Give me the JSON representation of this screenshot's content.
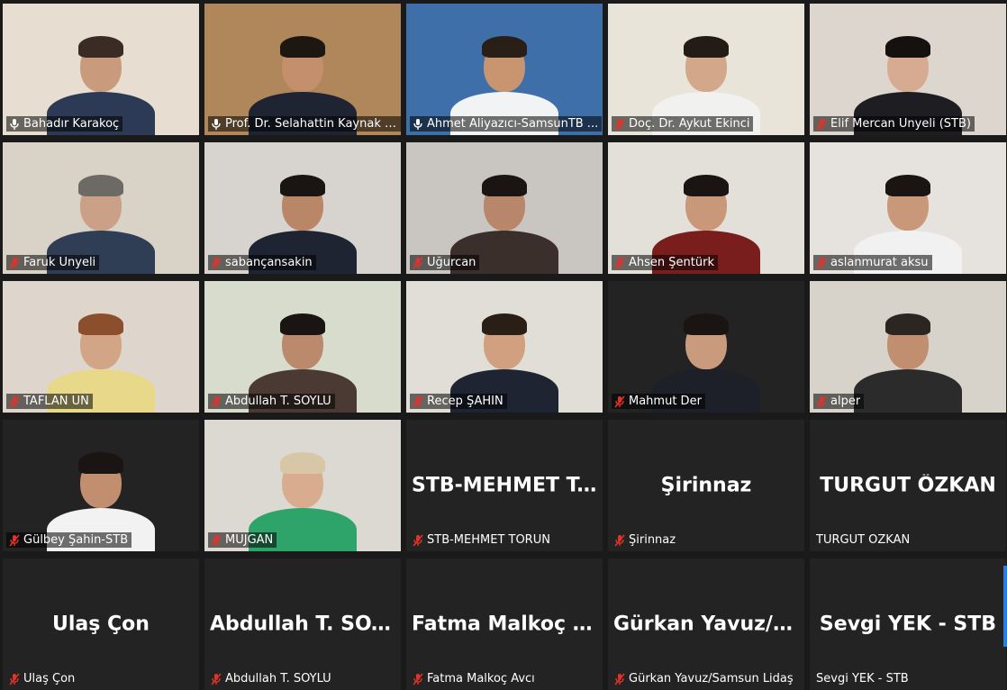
{
  "meeting": {
    "participants": [
      {
        "name": "Bahadır Karakoç",
        "muted": false,
        "video": true,
        "bg": "#e7ddd0",
        "shirt": "#2c3a55",
        "skin": "#c99a7c",
        "hair": "#3a2c24"
      },
      {
        "name": "Prof. Dr. Selahattin Kaynak / ...",
        "muted": false,
        "video": true,
        "bg": "#b0875a",
        "shirt": "#1f2433",
        "skin": "#c48f6d",
        "hair": "#1d1712"
      },
      {
        "name": "Ahmet Aliyazıcı-SamsunTB ...",
        "muted": false,
        "video": true,
        "active": true,
        "bg": "#3f6fa8",
        "shirt": "#f1f3f4",
        "skin": "#c99470",
        "hair": "#2a1f17"
      },
      {
        "name": "Doç. Dr. Aykut Ekinci",
        "muted": true,
        "video": true,
        "bg": "#e9e4da",
        "shirt": "#f1f1ef",
        "skin": "#d2a78a",
        "hair": "#231b16"
      },
      {
        "name": "Elif Mercan Ünyeli (STB)",
        "muted": true,
        "video": true,
        "bg": "#dcd6cf",
        "shirt": "#1d1d22",
        "skin": "#d7ab92",
        "hair": "#15110f"
      },
      {
        "name": "Faruk Ünyeli",
        "muted": true,
        "video": true,
        "bg": "#d9d2c6",
        "shirt": "#2f3e55",
        "skin": "#caa187",
        "hair": "#6d6a66"
      },
      {
        "name": "sabançansakin",
        "muted": true,
        "video": true,
        "bg": "#d7d4cf",
        "shirt": "#1f2433",
        "skin": "#b98767",
        "hair": "#1a1412"
      },
      {
        "name": "Uğurcan",
        "muted": true,
        "video": true,
        "bg": "#c9c6c1",
        "shirt": "#3a2f2a",
        "skin": "#b8866a",
        "hair": "#1a1412"
      },
      {
        "name": "Ahsen Şentürk",
        "muted": true,
        "video": true,
        "bg": "#e3e0da",
        "shirt": "#7a1d1d",
        "skin": "#c9987a",
        "hair": "#1a1412"
      },
      {
        "name": "aslanmurat aksu",
        "muted": true,
        "video": true,
        "bg": "#e6e3de",
        "shirt": "#f1f1f1",
        "skin": "#c9987a",
        "hair": "#1a1412"
      },
      {
        "name": "TAFLAN UN",
        "muted": true,
        "video": true,
        "bg": "#ded6cc",
        "shirt": "#e8d98a",
        "skin": "#d1a585",
        "hair": "#8c4f2e"
      },
      {
        "name": "Abdullah T. SOYLU",
        "muted": true,
        "video": true,
        "bg": "#d8dccc",
        "shirt": "#4a3a33",
        "skin": "#bb8a6c",
        "hair": "#1a1412"
      },
      {
        "name": "Recep ŞAHİN",
        "muted": true,
        "video": true,
        "bg": "#e1ded8",
        "shirt": "#1f2433",
        "skin": "#d0a080",
        "hair": "#2a1f17"
      },
      {
        "name": "Mahmut Der",
        "muted": true,
        "video": true,
        "bg": "#232323",
        "shirt": "#1d1f29",
        "skin": "#c99a7c",
        "hair": "#1a1412"
      },
      {
        "name": "alper",
        "muted": true,
        "video": true,
        "bg": "#d7d2ca",
        "shirt": "#2b2b2b",
        "skin": "#c18e70",
        "hair": "#2c2622"
      },
      {
        "name": "Gülbey Şahin-STB",
        "muted": true,
        "video": true,
        "bg": "#232323",
        "shirt": "#f2f2f2",
        "skin": "#c18e70",
        "hair": "#1a1412"
      },
      {
        "name": "MÜJGAN",
        "muted": true,
        "video": true,
        "bg": "#dcd9d3",
        "shirt": "#2ea36a",
        "skin": "#d9ac8f",
        "hair": "#d8c7a6"
      },
      {
        "name": "STB-MEHMET TORUN",
        "muted": true,
        "video": false,
        "display": "STB-MEHMET T..."
      },
      {
        "name": "Şirinnaz",
        "muted": true,
        "video": false,
        "display": "Şirinnaz"
      },
      {
        "name": "TURGUT ÖZKAN",
        "muted": null,
        "video": false,
        "display": "TURGUT ÖZKAN"
      },
      {
        "name": "Ulaş Çon",
        "muted": true,
        "video": false,
        "display": "Ulaş Çon"
      },
      {
        "name": "Abdullah T. SOYLU",
        "muted": true,
        "video": false,
        "display": "Abdullah T. SOY..."
      },
      {
        "name": "Fatma Malkoç Avcı",
        "muted": true,
        "video": false,
        "display": "Fatma Malkoç A..."
      },
      {
        "name": "Gürkan Yavuz/Samsun Lidaş",
        "muted": true,
        "video": false,
        "display": "Gürkan Yavuz/S..."
      },
      {
        "name": "Sevgi YEK - STB",
        "muted": null,
        "video": false,
        "display": "Sevgi YEK - STB"
      }
    ]
  },
  "colors": {
    "active_border": "#c9d63a",
    "muted_icon": "#e0332b",
    "unmuted_icon": "#ffffff",
    "tile_bg": "#232323",
    "scrollbar_accent": "#2d7de0"
  }
}
